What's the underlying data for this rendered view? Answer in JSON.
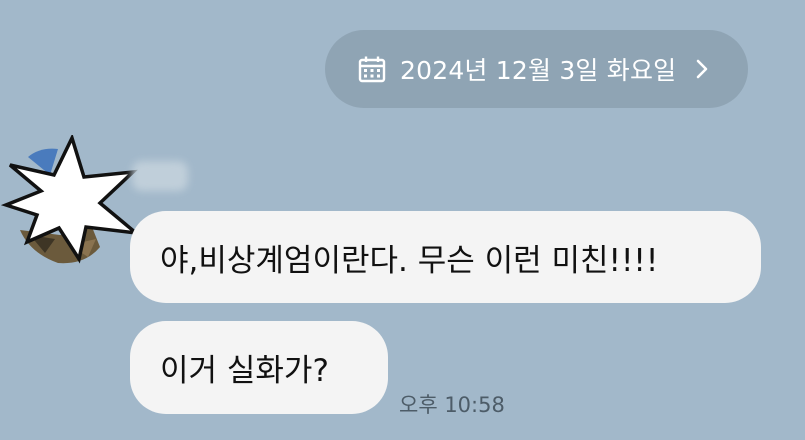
{
  "date_pill": {
    "label": "2024년 12월 3일 화요일",
    "icon": "calendar-icon",
    "chevron": "chevron-right-icon"
  },
  "messages": [
    {
      "text": "야,비상계엄이란다. 무슨 이런 미친!!!!"
    },
    {
      "text": "이거 실화가?"
    }
  ],
  "timestamp": "오후 10:58",
  "colors": {
    "background": "#a2b8ca",
    "date_pill": "#8fa4b4",
    "bubble": "#f4f4f4",
    "timestamp": "#4d5c68"
  }
}
